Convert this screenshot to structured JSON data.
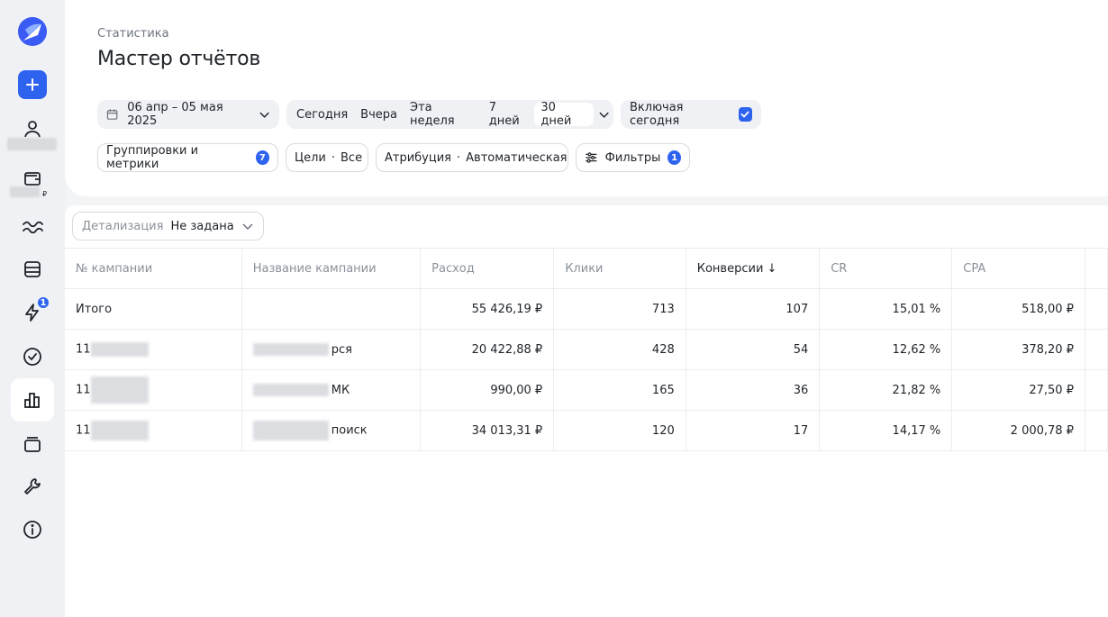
{
  "sidebar": {
    "badge": "1",
    "currency": "₽",
    "items": [
      "account-icon",
      "wallet-icon",
      "waves-icon",
      "database-icon",
      "lightning-icon",
      "check-circle-icon",
      "bar-chart-icon",
      "layers-icon",
      "wrench-icon",
      "info-icon"
    ]
  },
  "header": {
    "breadcrumb": "Статистика",
    "title": "Мастер отчётов"
  },
  "filters": {
    "date_range": "06 апр – 05 мая 2025",
    "periods": [
      "Сегодня",
      "Вчера",
      "Эта неделя",
      "7 дней",
      "30 дней"
    ],
    "selected_period": "30 дней",
    "include_today": "Включая сегодня",
    "include_today_checked": true,
    "groupings": "Группировки и метрики",
    "groupings_count": "7",
    "goals_label": "Цели",
    "goals_value": "Все",
    "attribution_label": "Атрибуция",
    "attribution_value": "Автоматическая",
    "filters_label": "Фильтры",
    "filters_count": "1"
  },
  "detail": {
    "label": "Детализация",
    "value": "Не задана"
  },
  "table": {
    "columns": [
      "№ кампании",
      "Название кампании",
      "Расход",
      "Клики",
      "Конверсии ↓",
      "CR",
      "CPA"
    ],
    "sorted_column": "Конверсии ↓",
    "total": {
      "label": "Итого",
      "spend": "55 426,19 ₽",
      "clicks": "713",
      "conversions": "107",
      "cr": "15,01 %",
      "cpa": "518,00 ₽"
    },
    "rows": [
      {
        "id": "11",
        "name_suffix": "рся",
        "spend": "20 422,88 ₽",
        "clicks": "428",
        "conversions": "54",
        "cr": "12,62 %",
        "cpa": "378,20 ₽"
      },
      {
        "id": "11",
        "name_suffix": "МК",
        "spend": "990,00 ₽",
        "clicks": "165",
        "conversions": "36",
        "cr": "21,82 %",
        "cpa": "27,50 ₽"
      },
      {
        "id": "11",
        "name_suffix": "поиск",
        "spend": "34 013,31 ₽",
        "clicks": "120",
        "conversions": "17",
        "cr": "14,17 %",
        "cpa": "2 000,78 ₽"
      }
    ]
  },
  "colors": {
    "accent": "#2e63f0",
    "sidebar_bg": "#f0f1f4"
  }
}
